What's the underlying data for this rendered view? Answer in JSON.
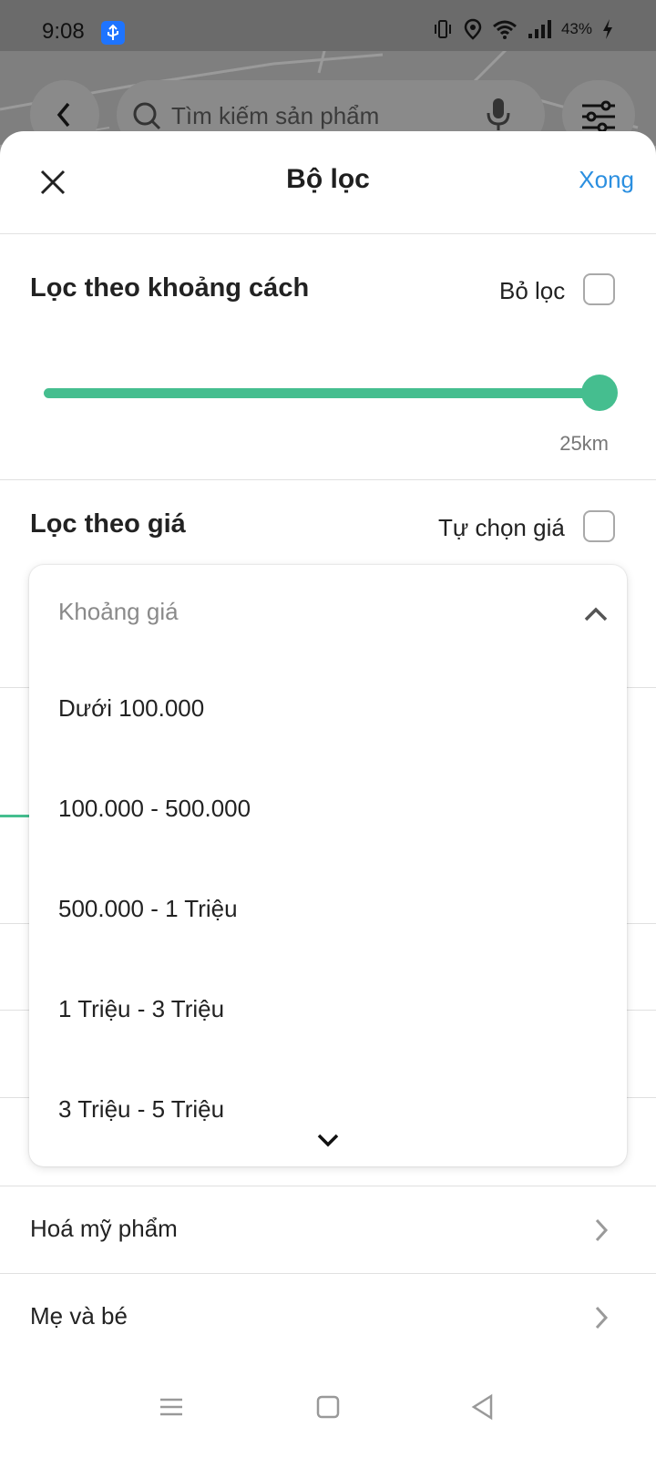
{
  "status_bar": {
    "time": "9:08",
    "battery": "43%",
    "icons": [
      "usb-icon",
      "vibrate-icon",
      "location-icon",
      "wifi-icon",
      "signal-icon",
      "charging-icon"
    ]
  },
  "background": {
    "search_placeholder": "Tìm kiếm sản phẩm",
    "icons": [
      "back-icon",
      "search-icon",
      "mic-icon",
      "filter-icon"
    ]
  },
  "sheet": {
    "title": "Bộ lọc",
    "close_icon": "close-icon",
    "done_label": "Xong",
    "distance": {
      "title": "Lọc theo khoảng cách",
      "clear_label": "Bỏ lọc",
      "clear_checked": false,
      "slider_fraction": 1.0,
      "value_label": "25km"
    },
    "price": {
      "title": "Lọc theo giá",
      "custom_label": "Tự chọn giá",
      "custom_checked": false
    },
    "price_dropdown": {
      "placeholder": "Khoảng giá",
      "expanded": true,
      "options": [
        "Dưới 100.000",
        "100.000 - 500.000",
        "500.000 - 1 Triệu",
        "1 Triệu - 3 Triệu",
        "3 Triệu - 5 Triệu"
      ]
    },
    "categories": [
      {
        "label": "Hoá mỹ phẩm"
      },
      {
        "label": "Mẹ và bé"
      }
    ]
  },
  "colors": {
    "accent": "#45be8f",
    "link": "#2b8fe0",
    "text": "#222222",
    "muted": "#8a8a8a"
  },
  "nav_bar": {
    "icons": [
      "menu-icon",
      "home-icon",
      "back-triangle-icon"
    ]
  }
}
